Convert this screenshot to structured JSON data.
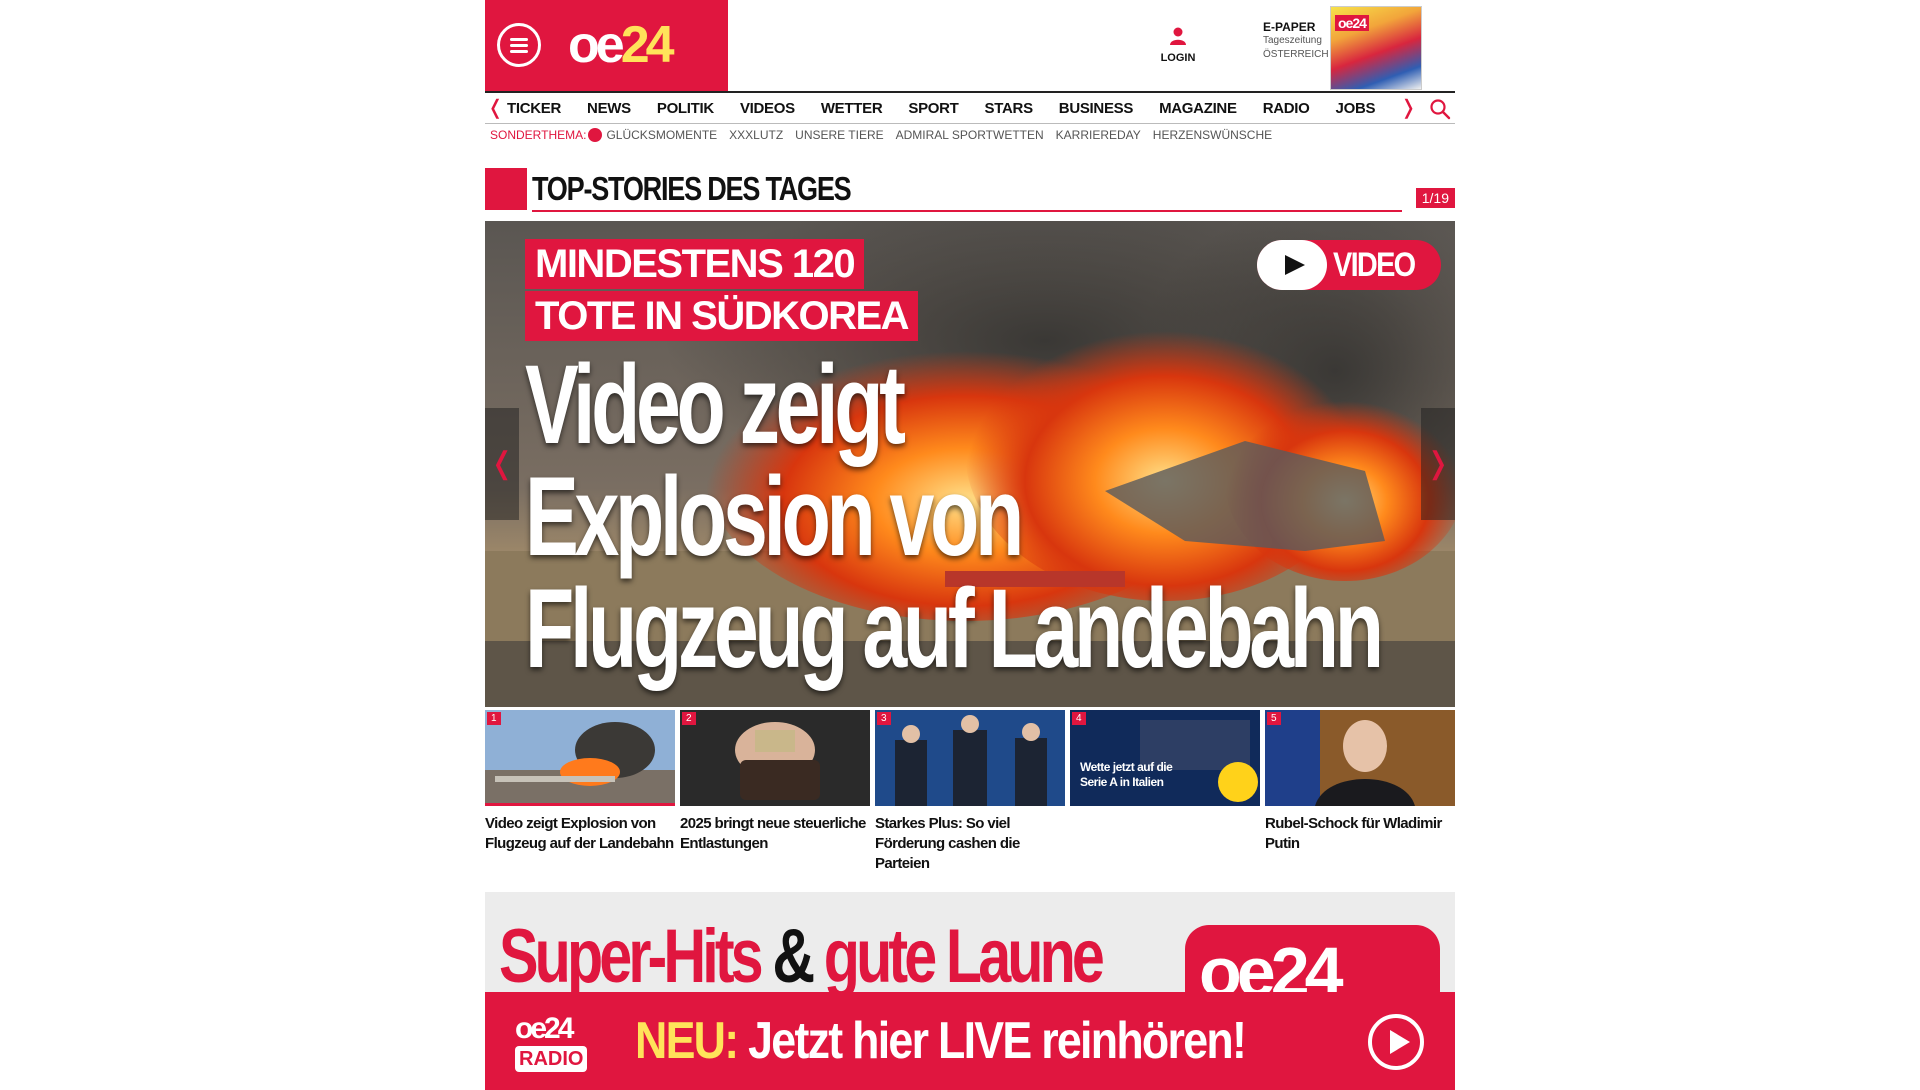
{
  "header": {
    "logo": {
      "part1": "oe",
      "part2": "24"
    },
    "login_label": "LOGIN",
    "epaper": {
      "title": "E-PAPER",
      "line1": "Tageszeitung",
      "line2": "ÖSTERREICH"
    },
    "epaper_cover_logo": "oe24"
  },
  "nav": {
    "items": [
      "TICKER",
      "NEWS",
      "POLITIK",
      "VIDEOS",
      "WETTER",
      "SPORT",
      "STARS",
      "BUSINESS",
      "MAGAZINE",
      "RADIO",
      "JOBS"
    ]
  },
  "subnav": {
    "label": "SONDERTHEMA:",
    "items": [
      "GLÜCKSMOMENTE",
      "XXXLUTZ",
      "UNSERE TIERE",
      "ADMIRAL SPORTWETTEN",
      "KARRIEREDAY",
      "HERZENSWÜNSCHE"
    ]
  },
  "section": {
    "title": "TOP-STORIES DES TAGES",
    "counter": "1/19"
  },
  "hero": {
    "kicker_line1": "MINDESTENS 120",
    "kicker_line2": "TOTE IN SÜDKOREA",
    "headline_line1": "Video zeigt",
    "headline_line2": "Explosion von",
    "headline_line3": "Flugzeug auf Landebahn",
    "video_label": "VIDEO"
  },
  "thumbs": [
    {
      "num": "1",
      "caption": "Video zeigt Explosion von Flugzeug auf der Landebahn"
    },
    {
      "num": "2",
      "caption": "2025 bringt neue steuerliche Entlastungen"
    },
    {
      "num": "3",
      "caption": "Starkes Plus: So viel Förderung cashen die Parteien"
    },
    {
      "num": "4",
      "caption": "",
      "ad_text": "Wette jetzt auf die Serie A in Italien"
    },
    {
      "num": "5",
      "caption": "Rubel-Schock für Wladimir Putin"
    }
  ],
  "radio": {
    "banner_part1": "Super-Hits",
    "banner_amp": "&",
    "banner_part2": "gute Laune",
    "banner_logo": "oe24",
    "logo_top": "oe24",
    "logo_bottom": "RADIO",
    "neu": "NEU:",
    "cta": "Jetzt hier LIVE reinhören!"
  }
}
